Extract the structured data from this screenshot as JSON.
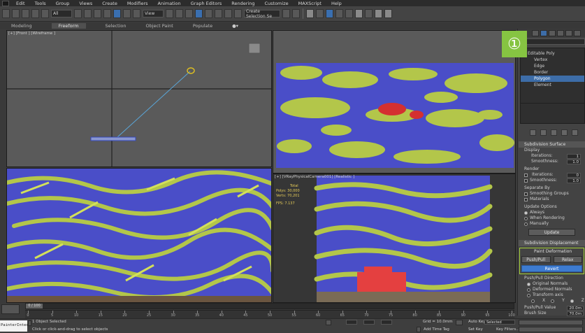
{
  "menu": [
    "Edit",
    "Tools",
    "Group",
    "Views",
    "Create",
    "Modifiers",
    "Animation",
    "Graph Editors",
    "Rendering",
    "Customize",
    "MAXScript",
    "Help"
  ],
  "toolbar": {
    "filter_select": "All",
    "view_select": "View",
    "selection_set": "Create Selection Se"
  },
  "ribbon": {
    "tabs": [
      "Modeling",
      "Freeform",
      "Selection",
      "Object Paint",
      "Populate"
    ],
    "active": "Freeform",
    "extra_icon": "toggle-icon"
  },
  "viewports": {
    "front_label": "[+] [Front ] [Wireframe ]",
    "camera_label": "[+] [VRayPhysicalCamera001] [Realistic ]",
    "stats": {
      "total_label": "Total",
      "polys_label": "Polys:",
      "polys_value": "30,000",
      "verts_label": "Verts:",
      "verts_value": "70,201",
      "fps_label": "FPS:",
      "fps_value": "7.137"
    }
  },
  "badge": "①",
  "command_panel": {
    "stack": [
      {
        "label": "Editable Poly",
        "level": "parent",
        "selected": false
      },
      {
        "label": "Vertex",
        "level": "child",
        "selected": false
      },
      {
        "label": "Edge",
        "level": "child",
        "selected": false
      },
      {
        "label": "Border",
        "level": "child",
        "selected": false
      },
      {
        "label": "Polygon",
        "level": "child",
        "selected": true
      },
      {
        "label": "Element",
        "level": "child",
        "selected": false
      }
    ],
    "rollout_subdivision_surface": "Subdivision Surface",
    "display": {
      "title": "Display",
      "iterations_label": "Iterations:",
      "iterations_value": "1",
      "smoothness_label": "Smoothness:",
      "smoothness_value": "1.0"
    },
    "render": {
      "title": "Render",
      "iterations_label": "Iterations:",
      "iterations_value": "0",
      "smoothness_label": "Smoothness:",
      "smoothness_value": "1.0"
    },
    "separate_by": {
      "title": "Separate By",
      "smoothing_groups": "Smoothing Groups",
      "materials": "Materials"
    },
    "update_options": {
      "title": "Update Options",
      "always": "Always",
      "when_rendering": "When Rendering",
      "manually": "Manually",
      "update_button": "Update"
    },
    "subdivision_displacement": "Subdivision Displacement",
    "paint_deformation": {
      "title": "Paint Deformation",
      "push_pull": "Push/Pull",
      "relax": "Relax",
      "revert": "Revert"
    },
    "push_pull_direction": {
      "title": "Push/Pull Direction",
      "original_normals": "Original Normals",
      "deformed_normals": "Deformed Normals",
      "transform_axis": "Transform axis",
      "x": "X",
      "y": "Y",
      "z": "Z"
    },
    "push_pull_value_label": "Push/Pull Value",
    "push_pull_value": "20.0m",
    "brush_size_label": "Brush Size",
    "brush_size": "70.0m"
  },
  "timeline": {
    "position": "0 / 100",
    "ticks": [
      "0",
      "5",
      "10",
      "15",
      "20",
      "25",
      "30",
      "35",
      "40",
      "45",
      "50",
      "55",
      "60",
      "65",
      "70",
      "75",
      "80",
      "85",
      "90",
      "95",
      "100"
    ]
  },
  "status": {
    "maxscript_text": "PainterInterfa",
    "objects_selected": "1 Object Selected",
    "prompt": "Click or click-and-drag to select objects",
    "grid": "Grid = 10.0mm",
    "add_time_tag": "Add Time Tag",
    "auto_key": "Auto Key",
    "set_key": "Set Key",
    "selected": "Selected",
    "key_filters": "Key Filters..."
  }
}
